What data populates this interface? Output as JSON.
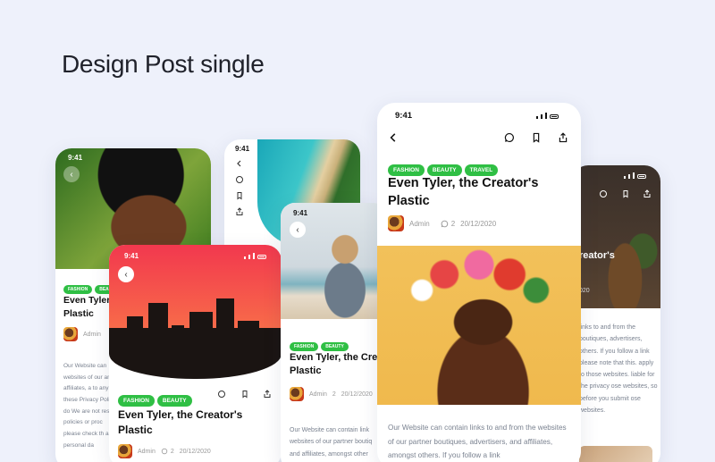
{
  "page": {
    "title": "Design Post single"
  },
  "status": {
    "time": "9:41"
  },
  "post": {
    "tags": [
      "FASHION",
      "BEAUTY",
      "TRAVEL"
    ],
    "title": "Even Tyler, the Creator's Plastic",
    "author": "Admin",
    "comments": "2",
    "date": "20/12/2020",
    "body": "Our Website can contain links to and from the websites of our partner boutiques, advertisers, and affiliates, amongst others. If you follow a link"
  },
  "cards": {
    "left": {
      "title_line1": "Even Tyler,",
      "title_line2": "Plastic",
      "body": "Our Website can websites of our and affiliates, a to any of these Privacy Policy do We are not resp policies or proc please check th any personal da"
    },
    "middle": {
      "title_line1": "Even Tyler, the Cre",
      "title_line2": "Plastic",
      "body": "Our Website can contain link websites of our partner boutiq and affiliates, amongst other"
    },
    "right": {
      "title_partial": "reator's",
      "date_partial": "020",
      "body": "links to and from the boutiques, advertisers, others. If you follow a link please note that this. apply to those websites. liable for the privacy ose websites, so before you submit ose websites."
    }
  },
  "colors": {
    "accent": "#2fbf44",
    "background": "#eef1fb"
  }
}
